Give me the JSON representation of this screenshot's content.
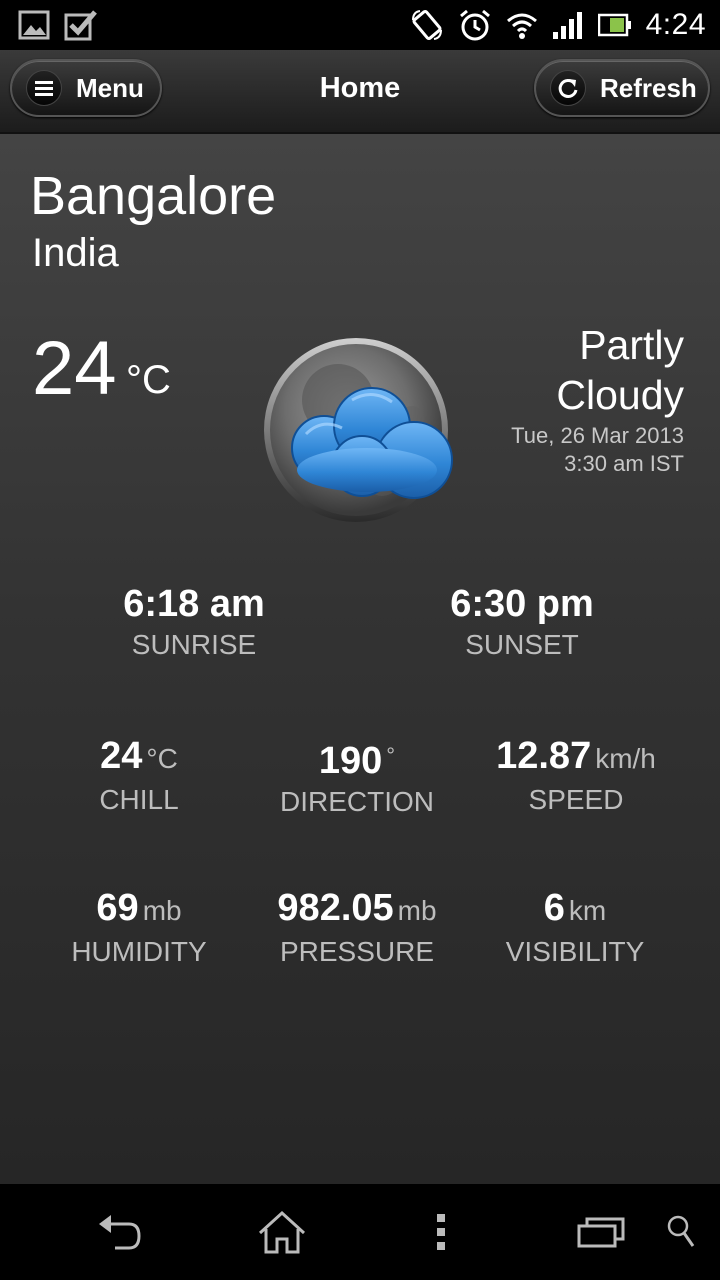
{
  "status_bar": {
    "time": "4:24",
    "icons": [
      "gallery-icon",
      "checkbox-icon",
      "rotate-icon",
      "alarm-icon",
      "wifi-icon",
      "signal-icon",
      "battery-icon"
    ]
  },
  "action_bar": {
    "menu_label": "Menu",
    "title": "Home",
    "refresh_label": "Refresh"
  },
  "location": {
    "city": "Bangalore",
    "country": "India"
  },
  "current": {
    "temperature": "24",
    "temperature_unit": "°C",
    "condition_line1": "Partly",
    "condition_line2": "Cloudy",
    "date": "Tue, 26 Mar 2013",
    "time": "3:30 am IST",
    "icon": "partly-cloudy-night-icon"
  },
  "sun": {
    "sunrise_value": "6:18 am",
    "sunrise_label": "SUNRISE",
    "sunset_value": "6:30 pm",
    "sunset_label": "SUNSET"
  },
  "wind": {
    "chill_value": "24",
    "chill_unit": "°C",
    "chill_label": "CHILL",
    "direction_value": "190",
    "direction_unit": "°",
    "direction_label": "DIRECTION",
    "speed_value": "12.87",
    "speed_unit": "km/h",
    "speed_label": "SPEED"
  },
  "atmosphere": {
    "humidity_value": "69",
    "humidity_unit": "mb",
    "humidity_label": "HUMIDITY",
    "pressure_value": "982.05",
    "pressure_unit": "mb",
    "pressure_label": "PRESSURE",
    "visibility_value": "6",
    "visibility_unit": "km",
    "visibility_label": "VISIBILITY"
  },
  "nav_bar": {
    "icons": [
      "back-icon",
      "home-icon",
      "more-icon",
      "recent-apps-icon",
      "search-icon"
    ]
  }
}
